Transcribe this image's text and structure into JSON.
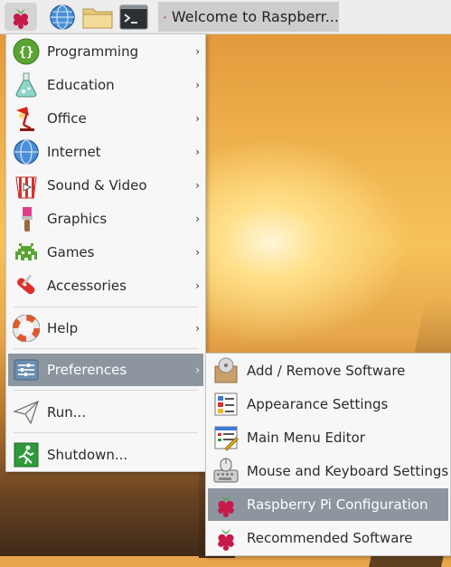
{
  "taskbar": {
    "menu_icon": "raspberry-icon",
    "web_icon": "globe-icon",
    "files_icon": "folder-icon",
    "terminal_icon": "terminal-icon",
    "task_title": "Welcome to Raspberr..."
  },
  "main_menu": {
    "items": [
      {
        "label": "Programming",
        "icon": "braces-icon"
      },
      {
        "label": "Education",
        "icon": "flask-icon"
      },
      {
        "label": "Office",
        "icon": "lamp-icon"
      },
      {
        "label": "Internet",
        "icon": "globe-icon"
      },
      {
        "label": "Sound & Video",
        "icon": "popcorn-icon"
      },
      {
        "label": "Graphics",
        "icon": "paintbrush-icon"
      },
      {
        "label": "Games",
        "icon": "space-invader-icon"
      },
      {
        "label": "Accessories",
        "icon": "swiss-knife-icon"
      },
      {
        "label": "Help",
        "icon": "lifebuoy-icon"
      },
      {
        "label": "Preferences",
        "icon": "sliders-icon"
      },
      {
        "label": "Run...",
        "icon": "paper-plane-icon"
      },
      {
        "label": "Shutdown...",
        "icon": "exit-icon"
      }
    ]
  },
  "preferences_menu": {
    "items": [
      {
        "label": "Add / Remove Software",
        "icon": "package-icon"
      },
      {
        "label": "Appearance Settings",
        "icon": "palette-icon"
      },
      {
        "label": "Main Menu Editor",
        "icon": "menu-editor-icon"
      },
      {
        "label": "Mouse and Keyboard Settings",
        "icon": "keyboard-mouse-icon"
      },
      {
        "label": "Raspberry Pi Configuration",
        "icon": "raspberry-icon"
      },
      {
        "label": "Recommended Software",
        "icon": "raspberry-icon"
      }
    ]
  },
  "colors": {
    "selection": "#8d969f",
    "menu_bg": "#f7f7f7",
    "raspberry_red": "#c51a4a",
    "leaf_green": "#4aa33a"
  }
}
